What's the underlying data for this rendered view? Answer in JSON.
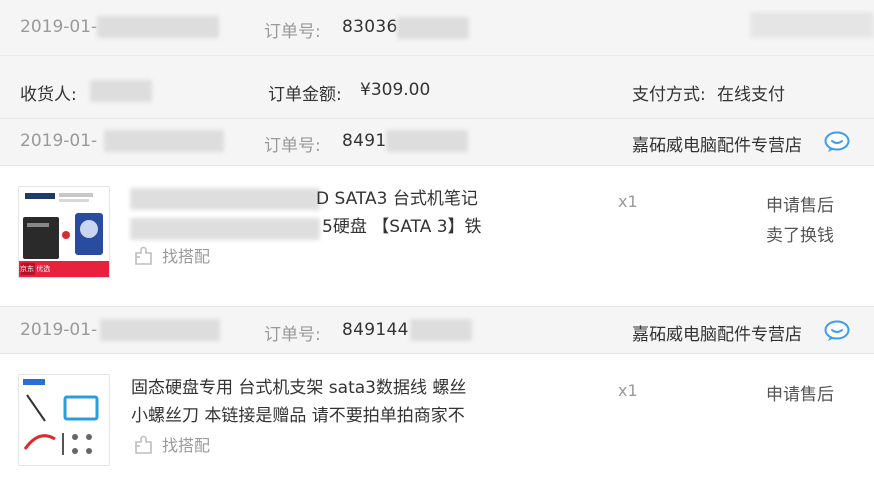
{
  "orders": [
    {
      "date_prefix": "2019-01-",
      "order_label": "订单号:",
      "order_no_prefix": "83036",
      "consignee_label": "收货人:",
      "amount_label": "订单金额:",
      "amount_value": "¥309.00",
      "pay_label": "支付方式:",
      "pay_value": "在线支付"
    },
    {
      "date_prefix": "2019-01-",
      "order_label": "订单号:",
      "order_no_prefix": "8491",
      "store": "嘉砳威电脑配件专营店",
      "item": {
        "title_line1": "D SATA3 台式机笔记",
        "title_line2": "5硬盘 【SATA 3】铁",
        "match_label": "找搭配",
        "qty": "x1",
        "actions": [
          "申请售后",
          "卖了换钱"
        ],
        "thumb_text": "京东 优选"
      }
    },
    {
      "date_prefix": "2019-01-",
      "order_label": "订单号:",
      "order_no_prefix": "849144",
      "store": "嘉砳威电脑配件专营店",
      "item": {
        "title_line1": "固态硬盘专用 台式机支架 sata3数据线 螺丝",
        "title_line2": "小螺丝刀 本链接是赠品 请不要拍单拍商家不",
        "match_label": "找搭配",
        "qty": "x1",
        "actions": [
          "申请售后"
        ]
      }
    }
  ],
  "icons": {
    "chat": "chat-bubble-icon",
    "match": "puzzle-icon"
  },
  "colors": {
    "header_bg": "#f5f5f5",
    "chat_blue": "#3c9cf0",
    "muted_text": "#9a9a9a"
  }
}
